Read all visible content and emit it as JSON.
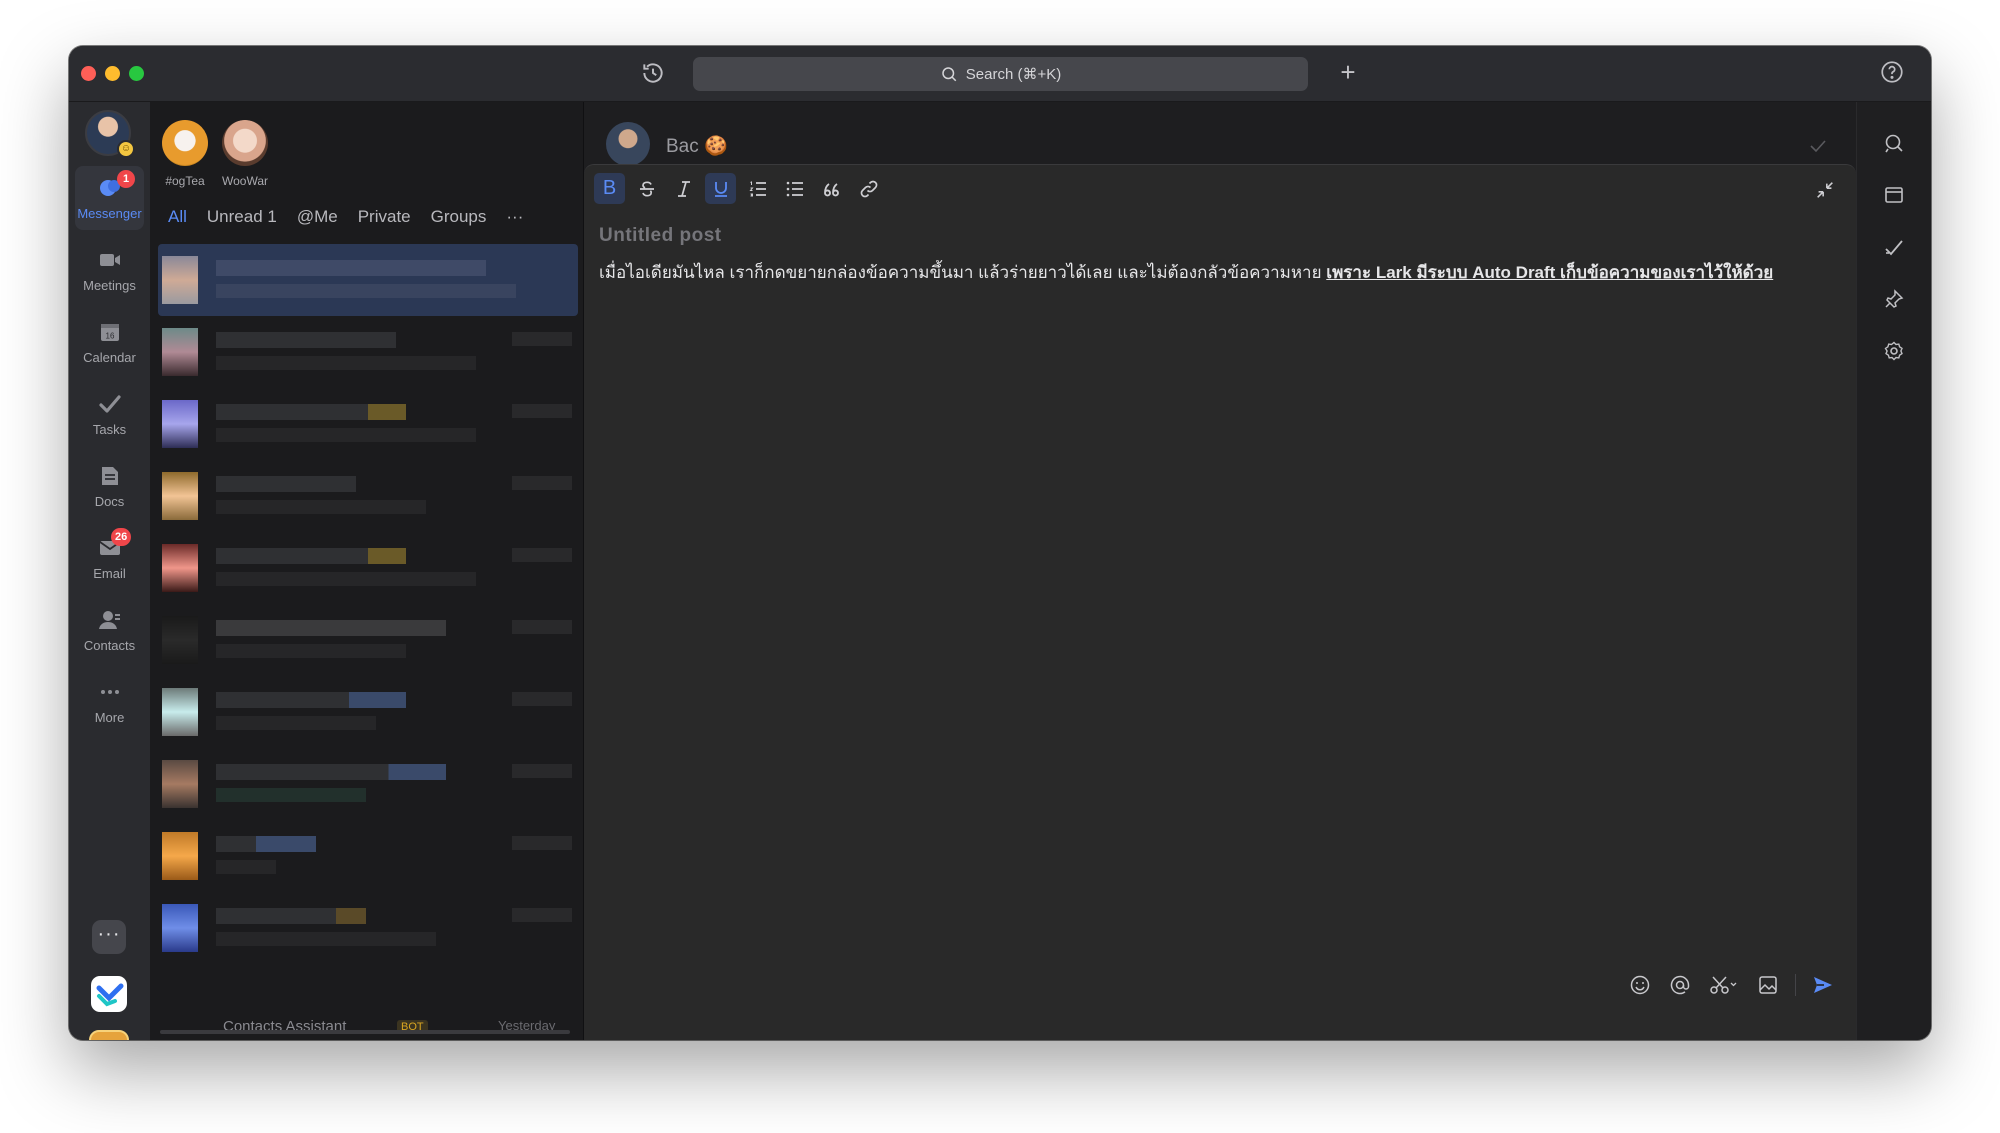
{
  "titlebar": {
    "search_label": "Search (⌘+K)",
    "plus_label": "+"
  },
  "nav": {
    "items": [
      {
        "label": "Messenger",
        "badge": "1"
      },
      {
        "label": "Meetings"
      },
      {
        "label": "Calendar",
        "icon_text": "16"
      },
      {
        "label": "Tasks"
      },
      {
        "label": "Docs"
      },
      {
        "label": "Email",
        "badge": "26"
      },
      {
        "label": "Contacts"
      },
      {
        "label": "More"
      }
    ]
  },
  "pinned": [
    {
      "name": "#ogTea"
    },
    {
      "name": "WooWar"
    }
  ],
  "filters": {
    "all": "All",
    "unread": "Unread 1",
    "at_me": "@Me",
    "private": "Private",
    "groups": "Groups",
    "more": "···"
  },
  "chat_last": {
    "name": "Contacts Assistant",
    "tag": "BOT",
    "time": "Yesterday"
  },
  "conversation": {
    "name": "Bac 🍪"
  },
  "editor": {
    "title_placeholder": "Untitled post",
    "body_plain": "เมื่อไอเดียมันไหล เราก็กดขยายกล่องข้อความขึ้นมา แล้วร่ายยาวได้เลย และไม่ต้องกลัวข้อความหาย ",
    "body_emph": "เพราะ Lark มีระบบ Auto Draft เก็บข้อความของเราไว้ให้ด้วย"
  },
  "colors": {
    "accent": "#5a8bf5",
    "badge": "#f0464a",
    "background": "#1e1e20"
  }
}
